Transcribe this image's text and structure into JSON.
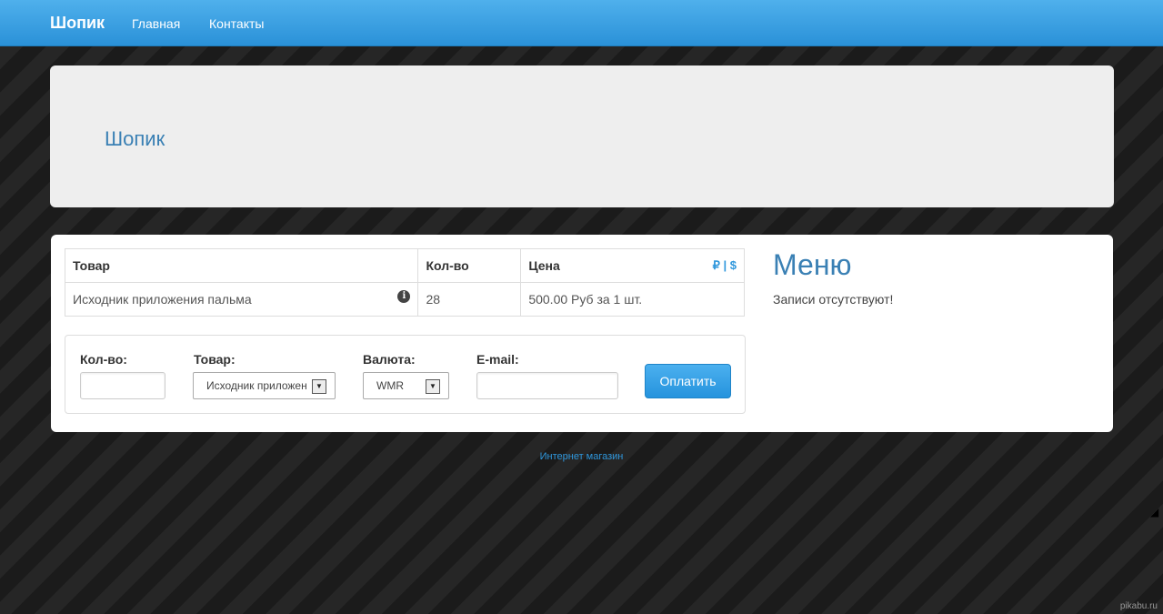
{
  "navbar": {
    "brand": "Шопик",
    "links": [
      "Главная",
      "Контакты"
    ]
  },
  "jumbotron": {
    "title": "Шопик"
  },
  "goods_table": {
    "columns": [
      "Товар",
      "Кол-во",
      "Цена"
    ],
    "currency_switch": {
      "rub": "₽",
      "sep": "|",
      "usd": "$"
    },
    "rows": [
      {
        "name": "Исходник приложения пальма",
        "qty": "28",
        "price": "500.00 Руб за 1 шт.",
        "icon": "info-icon"
      }
    ]
  },
  "order_form": {
    "qty_label": "Кол-во:",
    "qty_value": "",
    "product_label": "Товар:",
    "product_selected": "Исходник приложения пальма",
    "currency_label": "Валюта:",
    "currency_selected": "WMR",
    "email_label": "E-mail:",
    "email_value": "",
    "pay_button": "Оплатить"
  },
  "sidebar": {
    "title": "Меню",
    "empty_text": "Записи отсутствуют!"
  },
  "footer": {
    "link": "Интернет магазин"
  },
  "watermark": "pikabu.ru",
  "colors": {
    "navbar": "#2a91d8",
    "accent": "#2f97dc",
    "heading": "#3a80b4",
    "jumbotron_bg": "#eeeeee"
  }
}
